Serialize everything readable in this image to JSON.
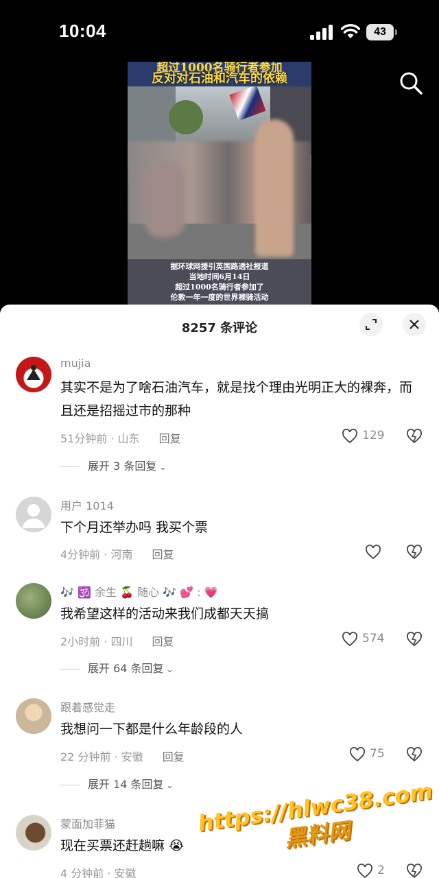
{
  "status_bar": {
    "time": "10:04",
    "battery": "43"
  },
  "video": {
    "caption_top_1": "超过1000名骑行者参加",
    "caption_top_2": "反对对石油和汽车的依赖",
    "caption_bottom": [
      "据环球网援引英国路透社报道",
      "当地时间6月14日",
      "超过1000名骑行者参加了",
      "伦敦一年一度的世界裸骑活动"
    ]
  },
  "sheet": {
    "title": "8257 条评论"
  },
  "comments": [
    {
      "username": "mujia",
      "text": "其实不是为了啥石油汽车，就是找个理由光明正大的裸奔，而且还是招摇过市的那种",
      "meta": "51分钟前 · 山东",
      "reply": "回复",
      "likes": "129",
      "more": "展开 3 条回复"
    },
    {
      "username": "用户 1014",
      "text": "下个月还举办吗 我买个票",
      "meta": "4分钟前 · 河南",
      "reply": "回复",
      "likes": ""
    },
    {
      "username": "🎶 🕉️ 余生 🍒 随心 🎶 💕 : 💗",
      "text": "我希望这样的活动来我们成都天天搞",
      "meta": "2小时前 · 四川",
      "reply": "回复",
      "likes": "574",
      "more": "展开 64 条回复"
    },
    {
      "username": "跟着感觉走",
      "text": "我想问一下都是什么年龄段的人",
      "meta": "22 分钟前 · 安徽",
      "reply": "回复",
      "likes": "75",
      "more": "展开 14 条回复"
    },
    {
      "username": "蒙面加菲猫",
      "text": "现在买票还赶趟嘛 😭",
      "meta": "4 分钟前 · 安徽",
      "reply": "",
      "likes": "2"
    }
  ],
  "watermark": {
    "line1": "https://hlwc38.com",
    "line2": "黑料网"
  },
  "icons": [
    "signal-icon",
    "wifi-icon",
    "battery-icon",
    "search-icon",
    "expand-icon",
    "close-icon",
    "heart-icon",
    "dislike-heart-icon",
    "chevron-down-icon"
  ]
}
